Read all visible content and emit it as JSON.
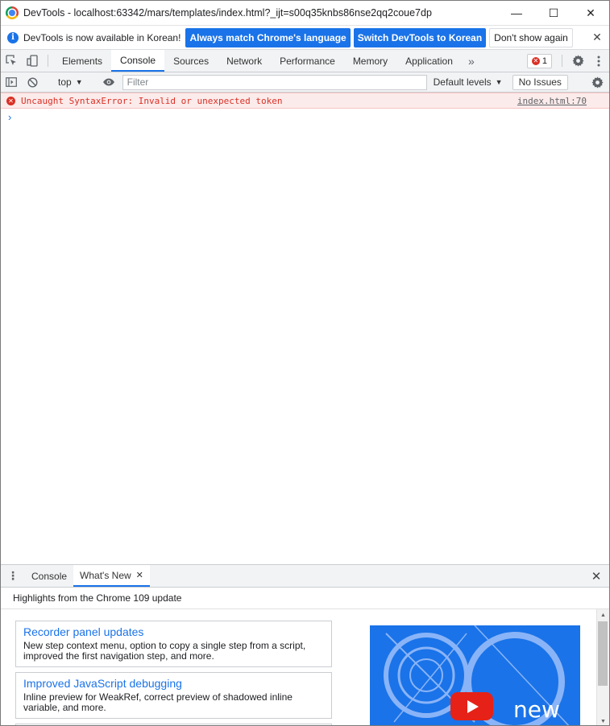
{
  "window": {
    "title": "DevTools - localhost:63342/mars/templates/index.html?_ijt=s00q35knbs86nse2qq2coue7dp",
    "minimize": "—",
    "maximize": "☐",
    "close": "✕"
  },
  "infobar": {
    "icon": "i",
    "text": "DevTools is now available in Korean!",
    "btn_match": "Always match Chrome's language",
    "btn_switch": "Switch DevTools to Korean",
    "btn_dismiss": "Don't show again",
    "close": "✕"
  },
  "tabs": {
    "items": [
      "Elements",
      "Console",
      "Sources",
      "Network",
      "Performance",
      "Memory",
      "Application"
    ],
    "active": "Console",
    "more": "»",
    "error_count": "1"
  },
  "console_toolbar": {
    "context": "top",
    "filter_placeholder": "Filter",
    "levels": "Default levels",
    "issues": "No Issues"
  },
  "messages": [
    {
      "level": "error",
      "text": "Uncaught SyntaxError: Invalid or unexpected token",
      "source": "index.html:70"
    }
  ],
  "prompt": "›",
  "drawer": {
    "tabs": [
      "Console",
      "What's New"
    ],
    "active": "What's New",
    "tab_close": "✕",
    "close": "✕",
    "header": "Highlights from the Chrome 109 update",
    "cards": [
      {
        "title": "Recorder panel updates",
        "desc": "New step context menu, option to copy a single step from a script, improved the first navigation step, and more."
      },
      {
        "title": "Improved JavaScript debugging",
        "desc": "Inline preview for WeakRef, correct preview of shadowed inline variable, and more."
      }
    ],
    "promo_text": "new"
  },
  "colors": {
    "accent": "#1a73e8",
    "error": "#d93025",
    "error_bg": "#fcebeb"
  }
}
